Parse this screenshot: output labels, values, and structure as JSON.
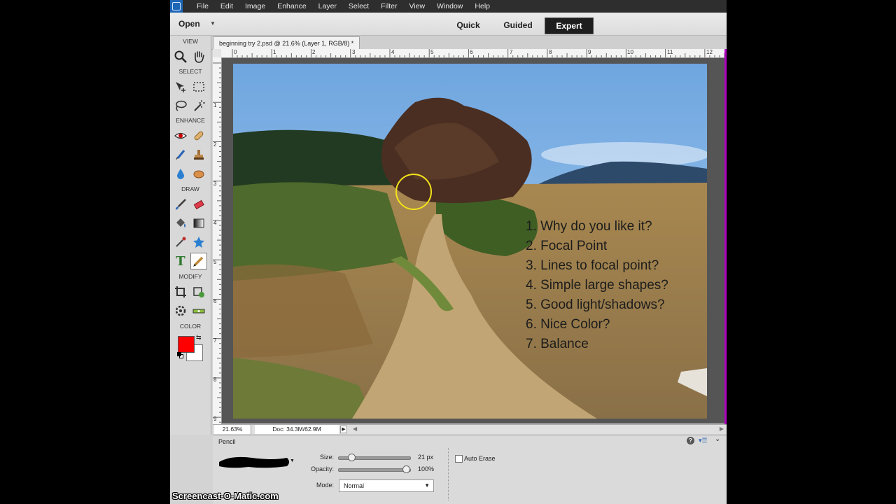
{
  "menubar": {
    "items": [
      "File",
      "Edit",
      "Image",
      "Enhance",
      "Layer",
      "Select",
      "Filter",
      "View",
      "Window",
      "Help"
    ]
  },
  "topbar": {
    "open_label": "Open",
    "modes": [
      "Quick",
      "Guided",
      "Expert"
    ],
    "active_mode": "Expert"
  },
  "toolbox": {
    "sections": {
      "view": "VIEW",
      "select": "SELECT",
      "enhance": "ENHANCE",
      "draw": "DRAW",
      "modify": "MODIFY",
      "color": "COLOR"
    },
    "type_tool_glyph": "T",
    "foreground_color": "#ff0000",
    "background_color": "#ffffff"
  },
  "document": {
    "tab_title": "beginning try 2.psd @ 21.6% (Layer 1, RGB/8) *",
    "ruler_h_labels": [
      "0",
      "1",
      "2",
      "3",
      "4",
      "5",
      "6",
      "7",
      "8",
      "9",
      "10",
      "11",
      "12"
    ],
    "ruler_v_labels": [
      "1",
      "2",
      "3",
      "4",
      "5",
      "6",
      "7",
      "8",
      "9"
    ],
    "overlay_lines": [
      "1. Why do you like it?",
      "2. Focal Point",
      "3. Lines to focal point?",
      "4. Simple large shapes?",
      "5. Good light/shadows?",
      "6. Nice Color?",
      "7. Balance"
    ]
  },
  "status": {
    "zoom": "21.63%",
    "doc_size": "Doc: 34.3M/62.9M"
  },
  "options": {
    "tool_name": "Pencil",
    "size_label": "Size:",
    "size_value": "21 px",
    "size_fraction": 0.14,
    "opacity_label": "Opacity:",
    "opacity_value": "100%",
    "opacity_fraction": 1.0,
    "mode_label": "Mode:",
    "mode_value": "Normal",
    "auto_erase_label": "Auto Erase",
    "auto_erase_checked": false
  },
  "watermark": "Screencast-O-Matic.com"
}
